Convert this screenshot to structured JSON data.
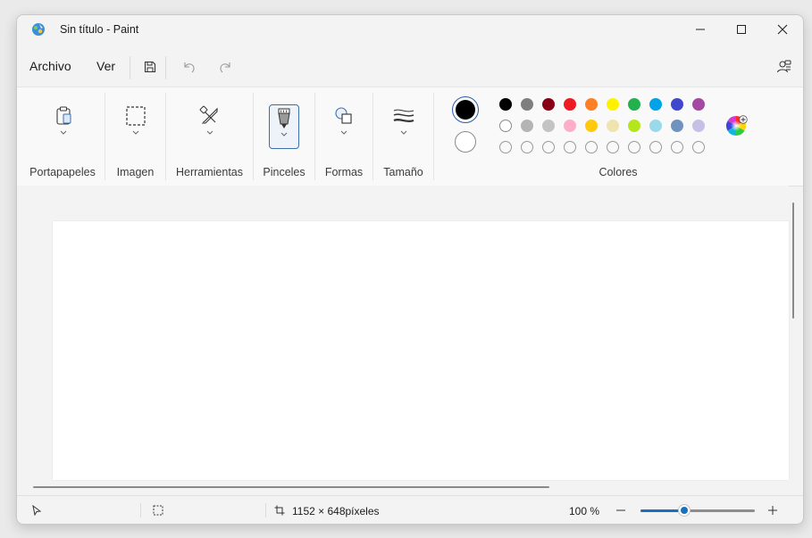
{
  "window": {
    "title": "Sin título - Paint"
  },
  "menu": {
    "file": "Archivo",
    "view": "Ver"
  },
  "ribbon": {
    "groups": [
      {
        "label": "Portapapeles",
        "icon": "clipboard-icon"
      },
      {
        "label": "Imagen",
        "icon": "selection-icon"
      },
      {
        "label": "Herramientas",
        "icon": "tools-icon"
      },
      {
        "label": "Pinceles",
        "icon": "brush-icon",
        "selected": true
      },
      {
        "label": "Formas",
        "icon": "shapes-icon"
      },
      {
        "label": "Tamaño",
        "icon": "stroke-size-icon"
      },
      {
        "label": "Colores",
        "icon": "palette"
      }
    ]
  },
  "colors": {
    "primary": "#000000",
    "secondary": "#ffffff",
    "row1": [
      "#000000",
      "#7f7f7f",
      "#880015",
      "#ed1c24",
      "#ff7f27",
      "#fff200",
      "#22b14c",
      "#00a2e8",
      "#3f48cc",
      "#a349a4"
    ],
    "row2": [
      "#ffffff",
      "#b4b4b4",
      "#c3c3c3",
      "#ffaec9",
      "#ffc90e",
      "#efe4b0",
      "#b5e61d",
      "#99d9ea",
      "#7092be",
      "#c8bfe7"
    ],
    "row3_empty_count": 10,
    "accent": "#1a6fbf"
  },
  "status": {
    "canvas_size": "1152 × 648píxeles",
    "zoom": "100 %",
    "zoom_fraction": 0.38
  }
}
